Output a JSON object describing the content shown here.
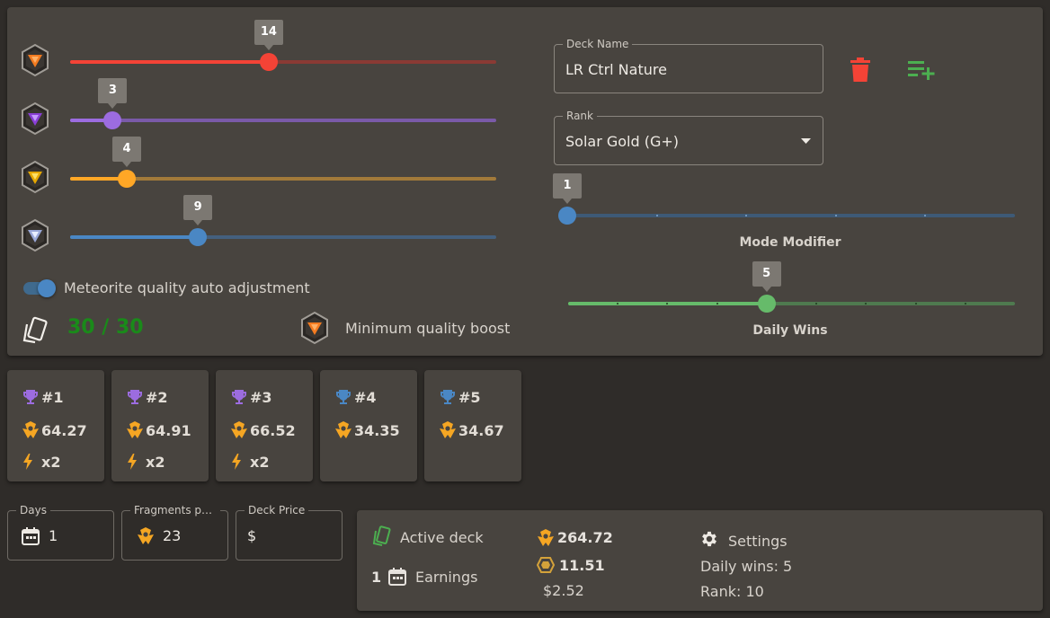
{
  "meteorites": [
    {
      "name": "orange",
      "value": 14,
      "fraction": 0.466,
      "color": "#f44336",
      "track_color": "#8a3a34"
    },
    {
      "name": "purple",
      "value": 3,
      "fraction": 0.1,
      "color": "#9c6ce0",
      "track_color": "#7a5aa8"
    },
    {
      "name": "gold",
      "value": 4,
      "fraction": 0.133,
      "color": "#ffa726",
      "track_color": "#a27a3a"
    },
    {
      "name": "silver",
      "value": 9,
      "fraction": 0.3,
      "color": "#4a87c4",
      "track_color": "#44607e"
    }
  ],
  "toggle": {
    "label": "Meteorite quality auto adjustment",
    "on": true
  },
  "card_count": {
    "text": "30 / 30",
    "color": "#1a8a1a"
  },
  "min_quality": {
    "label": "Minimum quality boost"
  },
  "deck_name": {
    "label": "Deck Name",
    "value": "LR Ctrl Nature"
  },
  "rank": {
    "label": "Rank",
    "value": "Solar Gold (G+)"
  },
  "mode_modifier": {
    "label": "Mode Modifier",
    "value": "1",
    "fraction": 0.0
  },
  "daily_wins": {
    "label": "Daily Wins",
    "value": "5",
    "fraction": 0.444
  },
  "colors": {
    "delete": "#f44336",
    "add": "#4caf50",
    "accent": "#4a87c4",
    "green": "#66bb6a",
    "orange": "#f5a623"
  },
  "cards": [
    {
      "rank": "#1",
      "value": "64.27",
      "boost": "x2",
      "trophy": "#9c6ce0"
    },
    {
      "rank": "#2",
      "value": "64.91",
      "boost": "x2",
      "trophy": "#9c6ce0"
    },
    {
      "rank": "#3",
      "value": "66.52",
      "boost": "x2",
      "trophy": "#9c6ce0"
    },
    {
      "rank": "#4",
      "value": "34.35",
      "boost": "",
      "trophy": "#4a87c4"
    },
    {
      "rank": "#5",
      "value": "34.67",
      "boost": "",
      "trophy": "#4a87c4"
    }
  ],
  "days": {
    "label": "Days",
    "value": "1"
  },
  "fragments": {
    "label": "Fragments per day",
    "value": "23"
  },
  "deck_price": {
    "label": "Deck Price",
    "value": "$"
  },
  "earnings": {
    "active_deck": "Active deck",
    "days": "1",
    "earnings_label": "Earnings",
    "fragments_total": "264.72",
    "coins": "11.51",
    "usd": "$2.52",
    "settings_label": "Settings",
    "daily_wins": "Daily wins: 5",
    "rank": "Rank: 10"
  }
}
